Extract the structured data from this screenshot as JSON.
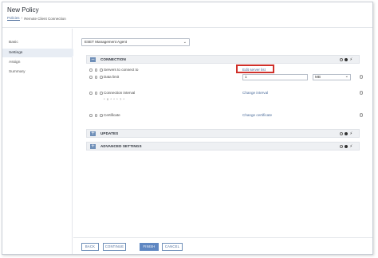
{
  "header": {
    "title": "New Policy",
    "breadcrumb": [
      "Policies",
      "Remote Client Connection"
    ]
  },
  "sidebar": {
    "items": [
      {
        "label": "Basic",
        "active": false
      },
      {
        "label": "Settings",
        "active": true
      },
      {
        "label": "Assign",
        "active": false
      },
      {
        "label": "Summary",
        "active": false
      }
    ]
  },
  "product_select": {
    "value": "ESET Management Agent"
  },
  "sections": {
    "connection": {
      "label": "CONNECTION",
      "toggle": "−"
    },
    "updates": {
      "label": "UPDATES",
      "toggle": "+"
    },
    "advanced": {
      "label": "ADVANCED SETTINGS",
      "toggle": "+"
    }
  },
  "rows": {
    "servers": {
      "label": "Servers to connect to",
      "link": "Edit server list"
    },
    "data_limit": {
      "label": "Data limit",
      "value": "1",
      "unit": "MB"
    },
    "interval": {
      "label": "Connection interval",
      "link": "Change interval",
      "note": "* 0 * * * ? *"
    },
    "certificate": {
      "label": "Certificate",
      "link": "Change certificate"
    }
  },
  "icons": {
    "bolt": "⚡",
    "chevron_down": "⌄"
  },
  "footer": {
    "back": "BACK",
    "continue": "CONTINUE",
    "finish": "FINISH",
    "cancel": "CANCEL"
  },
  "colors": {
    "accent": "#5f87c2",
    "highlight": "#d0302a",
    "section_bg": "#eef0f3"
  }
}
